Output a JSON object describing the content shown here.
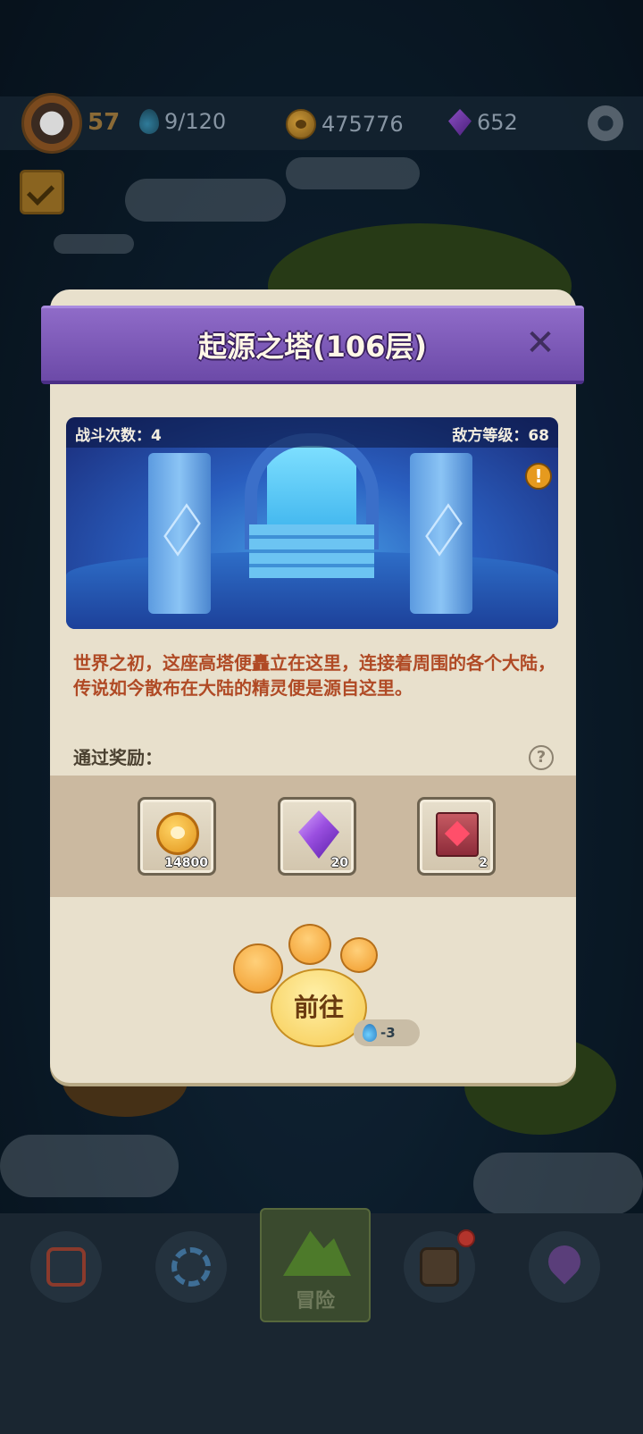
{
  "top_bar": {
    "level": "57",
    "energy": "9/120",
    "coins": "475776",
    "gems": "652"
  },
  "dialog": {
    "title": "起源之塔(106层)",
    "battle_count": "战斗次数：4",
    "enemy_level": "敌方等级：68",
    "description": "世界之初，这座高塔便矗立在这里，连接着周围的各个大陆，传说如今散布在大陆的精灵便是源自这里。",
    "rewards_label": "通过奖励：",
    "rewards": [
      {
        "icon": "coin-icon",
        "count": "14800"
      },
      {
        "icon": "gem-icon",
        "count": "20"
      },
      {
        "icon": "book-icon",
        "count": "2"
      }
    ],
    "go_button": "前往",
    "energy_cost": "-3"
  },
  "bottom_nav": {
    "active_label": "冒险"
  },
  "colors": {
    "header_purple": "#7b58b8",
    "description_text": "#b04a25",
    "dialog_bg": "#e8e0cc"
  }
}
